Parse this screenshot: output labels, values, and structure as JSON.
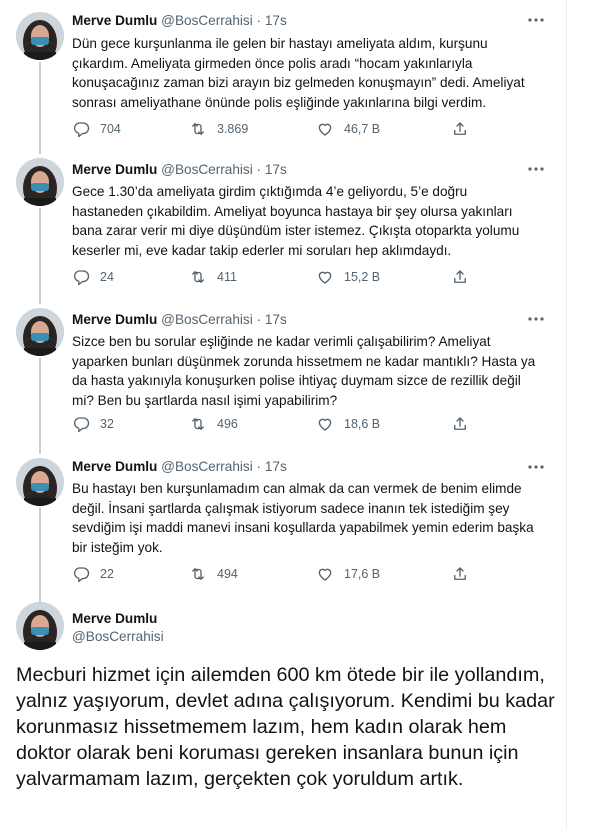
{
  "colors": {
    "text": "#0f1419",
    "muted": "#536471",
    "thread_line": "#c4cfd6",
    "divider": "#eff3f4"
  },
  "icons": {
    "reply": "reply-icon",
    "retweet": "retweet-icon",
    "like": "heart-icon",
    "share": "share-icon",
    "more": "more-dots-icon"
  },
  "tweets": [
    {
      "name": "Merve Dumlu",
      "handle": "@BosCerrahisi",
      "dot": "·",
      "time": "17s",
      "text": "Dün gece kurşunlanma ile gelen bir hastayı ameliyata aldım, kurşunu çıkardım. Ameliyata girmeden önce polis aradı “hocam yakınlarıyla konuşacağınız zaman bizi arayın biz gelmeden konuşmayın” dedi. Ameliyat sonrası ameliyathane önünde polis eşliğinde yakınlarına bilgi verdim.",
      "replies": "704",
      "retweets": "3.869",
      "likes": "46,7 B"
    },
    {
      "name": "Merve Dumlu",
      "handle": "@BosCerrahisi",
      "dot": "·",
      "time": "17s",
      "text": "Gece 1.30’da ameliyata girdim çıktığımda 4’e geliyordu, 5’e doğru hastaneden çıkabildim. Ameliyat boyunca hastaya bir şey olursa yakınları bana zarar verir mi diye düşündüm ister istemez. Çıkışta otoparkta yolumu keserler mi, eve kadar takip ederler mi soruları hep aklımdaydı.",
      "replies": "24",
      "retweets": "411",
      "likes": "15,2 B"
    },
    {
      "name": "Merve Dumlu",
      "handle": "@BosCerrahisi",
      "dot": "·",
      "time": "17s",
      "text": "Sizce ben bu sorular eşliğinde ne kadar verimli çalışabilirim? Ameliyat yaparken bunları düşünmek zorunda hissetmem ne kadar mantıklı? Hasta ya da hasta yakınıyla konuşurken polise ihtiyaç duymam sizce de rezillik değil mi? Ben bu şartlarda nasıl işimi yapabilirim?",
      "replies": "32",
      "retweets": "496",
      "likes": "18,6 B"
    },
    {
      "name": "Merve Dumlu",
      "handle": "@BosCerrahisi",
      "dot": "·",
      "time": "17s",
      "text": "Bu hastayı ben kurşunlamadım can almak da can vermek de benim elimde değil. İnsani şartlarda çalışmak istiyorum sadece inanın tek istediğim şey sevdiğim işi maddi manevi insani koşullarda yapabilmek yemin ederim başka bir isteğim yok.",
      "replies": "22",
      "retweets": "494",
      "likes": "17,6 B"
    }
  ],
  "main_tweet": {
    "name": "Merve Dumlu",
    "handle": "@BosCerrahisi",
    "text": "Mecburi hizmet için ailemden 600 km ötede bir ile yollandım, yalnız yaşıyorum, devlet adına çalışıyorum. Kendimi bu kadar korunmasız hissetmemem lazım, hem kadın olarak hem doktor olarak beni koruması gereken insanlara bunun için yalvarmamam lazım, gerçekten çok yoruldum artık."
  }
}
